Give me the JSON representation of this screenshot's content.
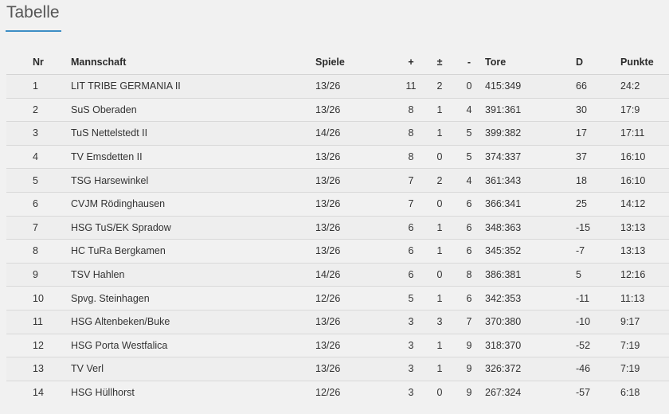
{
  "page": {
    "title": "Tabelle"
  },
  "table": {
    "headers": {
      "nr": "Nr",
      "team": "Mannschaft",
      "games": "Spiele",
      "wins": "+",
      "draws": "±",
      "losses": "-",
      "goals": "Tore",
      "diff": "D",
      "points": "Punkte"
    },
    "rows": [
      {
        "nr": "1",
        "team": "LIT TRIBE GERMANIA II",
        "games": "13/26",
        "wins": "11",
        "draws": "2",
        "losses": "0",
        "goals": "415:349",
        "diff": "66",
        "points": "24:2"
      },
      {
        "nr": "2",
        "team": "SuS Oberaden",
        "games": "13/26",
        "wins": "8",
        "draws": "1",
        "losses": "4",
        "goals": "391:361",
        "diff": "30",
        "points": "17:9"
      },
      {
        "nr": "3",
        "team": "TuS Nettelstedt II",
        "games": "14/26",
        "wins": "8",
        "draws": "1",
        "losses": "5",
        "goals": "399:382",
        "diff": "17",
        "points": "17:11"
      },
      {
        "nr": "4",
        "team": "TV Emsdetten II",
        "games": "13/26",
        "wins": "8",
        "draws": "0",
        "losses": "5",
        "goals": "374:337",
        "diff": "37",
        "points": "16:10"
      },
      {
        "nr": "5",
        "team": "TSG Harsewinkel",
        "games": "13/26",
        "wins": "7",
        "draws": "2",
        "losses": "4",
        "goals": "361:343",
        "diff": "18",
        "points": "16:10"
      },
      {
        "nr": "6",
        "team": "CVJM Rödinghausen",
        "games": "13/26",
        "wins": "7",
        "draws": "0",
        "losses": "6",
        "goals": "366:341",
        "diff": "25",
        "points": "14:12"
      },
      {
        "nr": "7",
        "team": "HSG TuS/EK Spradow",
        "games": "13/26",
        "wins": "6",
        "draws": "1",
        "losses": "6",
        "goals": "348:363",
        "diff": "-15",
        "points": "13:13"
      },
      {
        "nr": "8",
        "team": "HC TuRa Bergkamen",
        "games": "13/26",
        "wins": "6",
        "draws": "1",
        "losses": "6",
        "goals": "345:352",
        "diff": "-7",
        "points": "13:13"
      },
      {
        "nr": "9",
        "team": "TSV Hahlen",
        "games": "14/26",
        "wins": "6",
        "draws": "0",
        "losses": "8",
        "goals": "386:381",
        "diff": "5",
        "points": "12:16"
      },
      {
        "nr": "10",
        "team": "Spvg. Steinhagen",
        "games": "12/26",
        "wins": "5",
        "draws": "1",
        "losses": "6",
        "goals": "342:353",
        "diff": "-11",
        "points": "11:13"
      },
      {
        "nr": "11",
        "team": "HSG Altenbeken/Buke",
        "games": "13/26",
        "wins": "3",
        "draws": "3",
        "losses": "7",
        "goals": "370:380",
        "diff": "-10",
        "points": "9:17"
      },
      {
        "nr": "12",
        "team": "HSG Porta Westfalica",
        "games": "13/26",
        "wins": "3",
        "draws": "1",
        "losses": "9",
        "goals": "318:370",
        "diff": "-52",
        "points": "7:19"
      },
      {
        "nr": "13",
        "team": "TV Verl",
        "games": "13/26",
        "wins": "3",
        "draws": "1",
        "losses": "9",
        "goals": "326:372",
        "diff": "-46",
        "points": "7:19"
      },
      {
        "nr": "14",
        "team": "HSG Hüllhorst",
        "games": "12/26",
        "wins": "3",
        "draws": "0",
        "losses": "9",
        "goals": "267:324",
        "diff": "-57",
        "points": "6:18"
      }
    ]
  },
  "colors": {
    "accent": "#3d8ec5",
    "background": "#f1f1f1"
  }
}
